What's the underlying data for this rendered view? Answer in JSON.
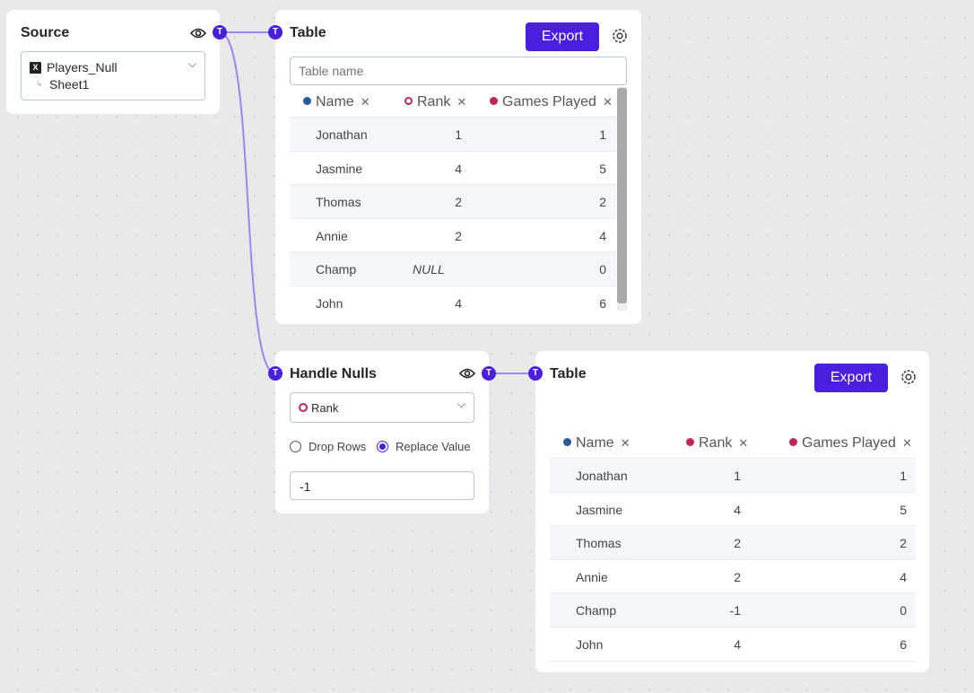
{
  "source": {
    "title": "Source",
    "file": "Players_Null",
    "sheet": "Sheet1"
  },
  "node_label": "T",
  "table1": {
    "title": "Table",
    "export": "Export",
    "name_placeholder": "Table name",
    "columns": [
      "Name",
      "Rank",
      "Games Played"
    ],
    "rows": [
      [
        "Jonathan",
        "1",
        "1"
      ],
      [
        "Jasmine",
        "4",
        "5"
      ],
      [
        "Thomas",
        "2",
        "2"
      ],
      [
        "Annie",
        "2",
        "4"
      ],
      [
        "Champ",
        "NULL",
        "0"
      ],
      [
        "John",
        "4",
        "6"
      ]
    ]
  },
  "handle_nulls": {
    "title": "Handle Nulls",
    "column": "Rank",
    "options": [
      "Drop Rows",
      "Replace Value"
    ],
    "selected": "Replace Value",
    "value": "-1"
  },
  "table2": {
    "title": "Table",
    "export": "Export",
    "columns": [
      "Name",
      "Rank",
      "Games Played"
    ],
    "rows": [
      [
        "Jonathan",
        "1",
        "1"
      ],
      [
        "Jasmine",
        "4",
        "5"
      ],
      [
        "Thomas",
        "2",
        "2"
      ],
      [
        "Annie",
        "2",
        "4"
      ],
      [
        "Champ",
        "-1",
        "0"
      ],
      [
        "John",
        "4",
        "6"
      ]
    ]
  },
  "colors": {
    "accent": "#4a1fe0",
    "name": "#2a5a9a",
    "rank": "#c0245a",
    "games": "#c0245a"
  }
}
